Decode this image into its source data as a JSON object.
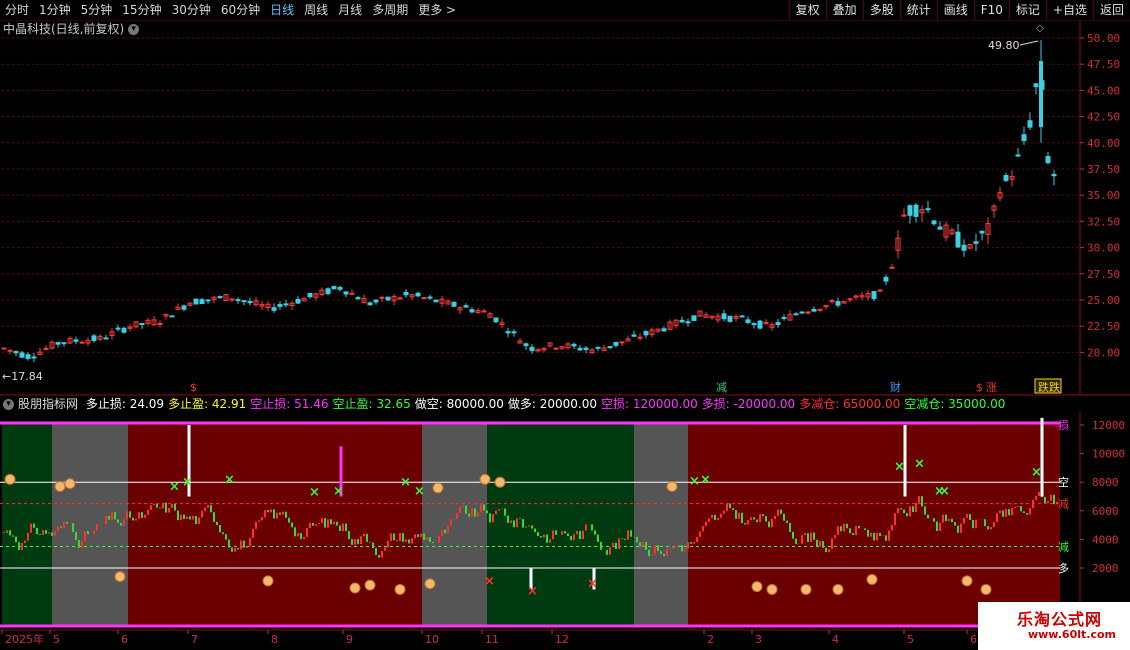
{
  "toolbar": {
    "periods": [
      "分时",
      "1分钟",
      "5分钟",
      "15分钟",
      "30分钟",
      "60分钟",
      "日线",
      "周线",
      "月线",
      "多周期",
      "更多 >"
    ],
    "active_period": "日线",
    "right_buttons": [
      "复权",
      "叠加",
      "多股",
      "统计",
      "画线",
      "F10",
      "标记",
      "+自选",
      "返回"
    ]
  },
  "main_chart": {
    "title": "中晶科技(日线,前复权)",
    "price_axis": [
      "50.00",
      "47.50",
      "45.00",
      "42.50",
      "40.00",
      "37.50",
      "35.00",
      "32.50",
      "30.00",
      "27.50",
      "25.00",
      "22.50",
      "20.00"
    ],
    "high_label": "49.80",
    "low_label": "17.84",
    "markers": [
      {
        "text": "$",
        "color": "#ff3030"
      },
      {
        "text": "减",
        "color": "#33cc66"
      },
      {
        "text": "财",
        "color": "#3aa0ff"
      },
      {
        "text": "$",
        "color": "#ff3030"
      },
      {
        "text": "涨",
        "color": "#ff3030"
      },
      {
        "text": "跌",
        "color": "#ffcc33"
      }
    ],
    "up_color": "#ff3a3a",
    "down_color": "#3ad0e0"
  },
  "indicator": {
    "name": "股朋指标网",
    "params": [
      {
        "label": "多止损:",
        "value": "24.09",
        "color": "#ffffff"
      },
      {
        "label": "多止盈:",
        "value": "42.91",
        "color": "#ffff00"
      },
      {
        "label": "空止损:",
        "value": "51.46",
        "color": "#ff33ff"
      },
      {
        "label": "空止盈:",
        "value": "32.65",
        "color": "#33ff33"
      },
      {
        "label": "做空:",
        "value": "80000.00",
        "color": "#ffffff"
      },
      {
        "label": "做多:",
        "value": "20000.00",
        "color": "#ffffff"
      },
      {
        "label": "空损:",
        "value": "120000.00",
        "color": "#ff33ff"
      },
      {
        "label": "多损:",
        "value": "-20000.00",
        "color": "#ff33ff"
      },
      {
        "label": "多减仓:",
        "value": "65000.00",
        "color": "#ff3030"
      },
      {
        "label": "空减仓:",
        "value": "35000.00",
        "color": "#33ff33"
      }
    ],
    "axis": [
      "12000",
      "10000",
      "8000",
      "6000",
      "4000",
      "2000"
    ],
    "zone_labels": [
      "损",
      "空",
      "减",
      "减",
      "多"
    ]
  },
  "date_axis": [
    "2025年",
    "5",
    "6",
    "7",
    "8",
    "9",
    "10",
    "11",
    "12",
    "2",
    "3",
    "4",
    "5",
    "6"
  ],
  "watermark": {
    "line1": "乐淘公式网",
    "line2": "www.60lt.com"
  }
}
